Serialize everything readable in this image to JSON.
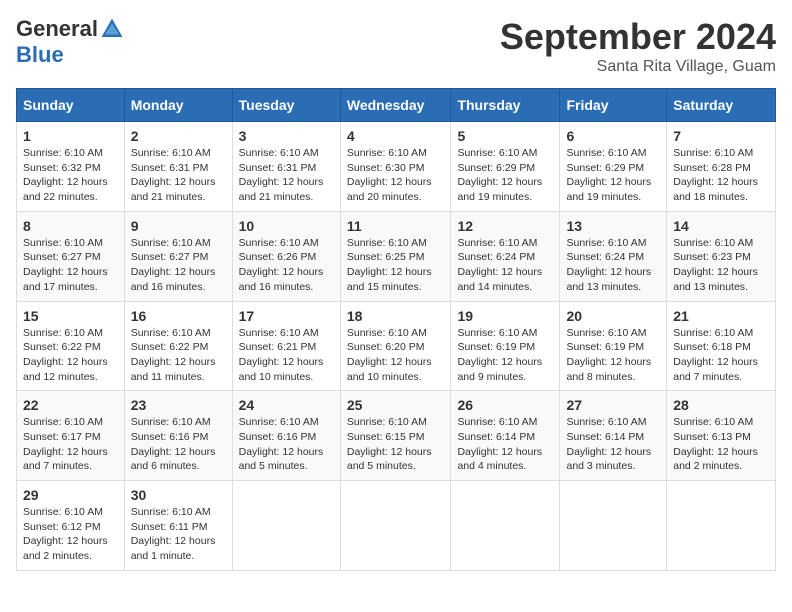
{
  "logo": {
    "general": "General",
    "blue": "Blue"
  },
  "title": "September 2024",
  "location": "Santa Rita Village, Guam",
  "days_of_week": [
    "Sunday",
    "Monday",
    "Tuesday",
    "Wednesday",
    "Thursday",
    "Friday",
    "Saturday"
  ],
  "weeks": [
    [
      {
        "day": "1",
        "sunrise": "Sunrise: 6:10 AM",
        "sunset": "Sunset: 6:32 PM",
        "daylight": "Daylight: 12 hours and 22 minutes."
      },
      {
        "day": "2",
        "sunrise": "Sunrise: 6:10 AM",
        "sunset": "Sunset: 6:31 PM",
        "daylight": "Daylight: 12 hours and 21 minutes."
      },
      {
        "day": "3",
        "sunrise": "Sunrise: 6:10 AM",
        "sunset": "Sunset: 6:31 PM",
        "daylight": "Daylight: 12 hours and 21 minutes."
      },
      {
        "day": "4",
        "sunrise": "Sunrise: 6:10 AM",
        "sunset": "Sunset: 6:30 PM",
        "daylight": "Daylight: 12 hours and 20 minutes."
      },
      {
        "day": "5",
        "sunrise": "Sunrise: 6:10 AM",
        "sunset": "Sunset: 6:29 PM",
        "daylight": "Daylight: 12 hours and 19 minutes."
      },
      {
        "day": "6",
        "sunrise": "Sunrise: 6:10 AM",
        "sunset": "Sunset: 6:29 PM",
        "daylight": "Daylight: 12 hours and 19 minutes."
      },
      {
        "day": "7",
        "sunrise": "Sunrise: 6:10 AM",
        "sunset": "Sunset: 6:28 PM",
        "daylight": "Daylight: 12 hours and 18 minutes."
      }
    ],
    [
      {
        "day": "8",
        "sunrise": "Sunrise: 6:10 AM",
        "sunset": "Sunset: 6:27 PM",
        "daylight": "Daylight: 12 hours and 17 minutes."
      },
      {
        "day": "9",
        "sunrise": "Sunrise: 6:10 AM",
        "sunset": "Sunset: 6:27 PM",
        "daylight": "Daylight: 12 hours and 16 minutes."
      },
      {
        "day": "10",
        "sunrise": "Sunrise: 6:10 AM",
        "sunset": "Sunset: 6:26 PM",
        "daylight": "Daylight: 12 hours and 16 minutes."
      },
      {
        "day": "11",
        "sunrise": "Sunrise: 6:10 AM",
        "sunset": "Sunset: 6:25 PM",
        "daylight": "Daylight: 12 hours and 15 minutes."
      },
      {
        "day": "12",
        "sunrise": "Sunrise: 6:10 AM",
        "sunset": "Sunset: 6:24 PM",
        "daylight": "Daylight: 12 hours and 14 minutes."
      },
      {
        "day": "13",
        "sunrise": "Sunrise: 6:10 AM",
        "sunset": "Sunset: 6:24 PM",
        "daylight": "Daylight: 12 hours and 13 minutes."
      },
      {
        "day": "14",
        "sunrise": "Sunrise: 6:10 AM",
        "sunset": "Sunset: 6:23 PM",
        "daylight": "Daylight: 12 hours and 13 minutes."
      }
    ],
    [
      {
        "day": "15",
        "sunrise": "Sunrise: 6:10 AM",
        "sunset": "Sunset: 6:22 PM",
        "daylight": "Daylight: 12 hours and 12 minutes."
      },
      {
        "day": "16",
        "sunrise": "Sunrise: 6:10 AM",
        "sunset": "Sunset: 6:22 PM",
        "daylight": "Daylight: 12 hours and 11 minutes."
      },
      {
        "day": "17",
        "sunrise": "Sunrise: 6:10 AM",
        "sunset": "Sunset: 6:21 PM",
        "daylight": "Daylight: 12 hours and 10 minutes."
      },
      {
        "day": "18",
        "sunrise": "Sunrise: 6:10 AM",
        "sunset": "Sunset: 6:20 PM",
        "daylight": "Daylight: 12 hours and 10 minutes."
      },
      {
        "day": "19",
        "sunrise": "Sunrise: 6:10 AM",
        "sunset": "Sunset: 6:19 PM",
        "daylight": "Daylight: 12 hours and 9 minutes."
      },
      {
        "day": "20",
        "sunrise": "Sunrise: 6:10 AM",
        "sunset": "Sunset: 6:19 PM",
        "daylight": "Daylight: 12 hours and 8 minutes."
      },
      {
        "day": "21",
        "sunrise": "Sunrise: 6:10 AM",
        "sunset": "Sunset: 6:18 PM",
        "daylight": "Daylight: 12 hours and 7 minutes."
      }
    ],
    [
      {
        "day": "22",
        "sunrise": "Sunrise: 6:10 AM",
        "sunset": "Sunset: 6:17 PM",
        "daylight": "Daylight: 12 hours and 7 minutes."
      },
      {
        "day": "23",
        "sunrise": "Sunrise: 6:10 AM",
        "sunset": "Sunset: 6:16 PM",
        "daylight": "Daylight: 12 hours and 6 minutes."
      },
      {
        "day": "24",
        "sunrise": "Sunrise: 6:10 AM",
        "sunset": "Sunset: 6:16 PM",
        "daylight": "Daylight: 12 hours and 5 minutes."
      },
      {
        "day": "25",
        "sunrise": "Sunrise: 6:10 AM",
        "sunset": "Sunset: 6:15 PM",
        "daylight": "Daylight: 12 hours and 5 minutes."
      },
      {
        "day": "26",
        "sunrise": "Sunrise: 6:10 AM",
        "sunset": "Sunset: 6:14 PM",
        "daylight": "Daylight: 12 hours and 4 minutes."
      },
      {
        "day": "27",
        "sunrise": "Sunrise: 6:10 AM",
        "sunset": "Sunset: 6:14 PM",
        "daylight": "Daylight: 12 hours and 3 minutes."
      },
      {
        "day": "28",
        "sunrise": "Sunrise: 6:10 AM",
        "sunset": "Sunset: 6:13 PM",
        "daylight": "Daylight: 12 hours and 2 minutes."
      }
    ],
    [
      {
        "day": "29",
        "sunrise": "Sunrise: 6:10 AM",
        "sunset": "Sunset: 6:12 PM",
        "daylight": "Daylight: 12 hours and 2 minutes."
      },
      {
        "day": "30",
        "sunrise": "Sunrise: 6:10 AM",
        "sunset": "Sunset: 6:11 PM",
        "daylight": "Daylight: 12 hours and 1 minute."
      },
      null,
      null,
      null,
      null,
      null
    ]
  ]
}
